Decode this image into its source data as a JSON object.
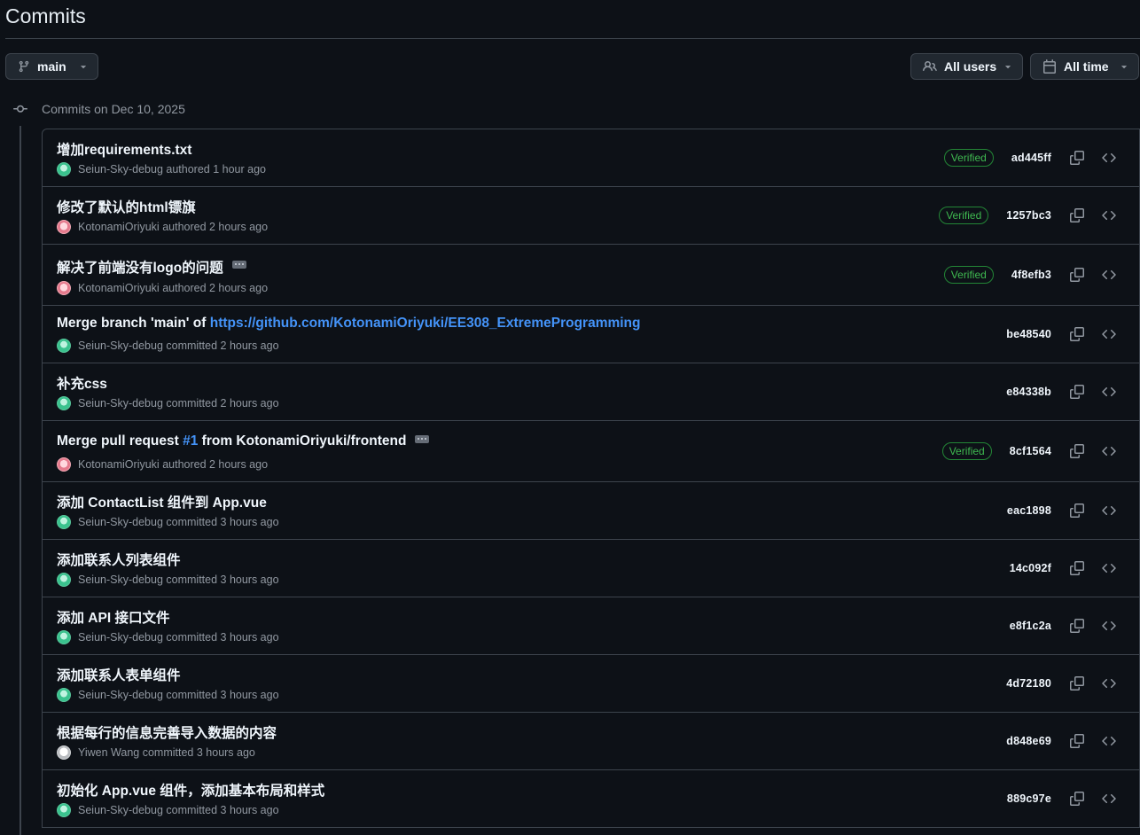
{
  "page": {
    "title": "Commits"
  },
  "filters": {
    "branch": {
      "label": "main",
      "icon": "git-branch-icon"
    },
    "users": {
      "label": "All users",
      "icon": "people-icon"
    },
    "time": {
      "label": "All time",
      "icon": "calendar-icon"
    }
  },
  "group": {
    "label": "Commits on Dec 10, 2025",
    "icon": "git-commit-icon"
  },
  "commits": [
    {
      "message": "增加requirements.txt",
      "author": "Seiun-Sky-debug",
      "action": "authored 1 hour ago",
      "verified": "Verified",
      "sha": "ad445ff",
      "avatar": "green"
    },
    {
      "message": "修改了默认的html镖旗",
      "author": "KotonamiOriyuki",
      "action": "authored 2 hours ago",
      "verified": "Verified",
      "sha": "1257bc3",
      "avatar": "pink"
    },
    {
      "message": "解决了前端没有logo的问题",
      "author": "KotonamiOriyuki",
      "action": "authored 2 hours ago",
      "verified": "Verified",
      "sha": "4f8efb3",
      "avatar": "pink",
      "expandable": true
    },
    {
      "message_prefix": "Merge branch 'main' of ",
      "message_link": "https://github.com/KotonamiOriyuki/EE308_ExtremeProgramming",
      "author": "Seiun-Sky-debug",
      "action": "committed 2 hours ago",
      "sha": "be48540",
      "avatar": "green"
    },
    {
      "message": "补充css",
      "author": "Seiun-Sky-debug",
      "action": "committed 2 hours ago",
      "sha": "e84338b",
      "avatar": "green"
    },
    {
      "message_prefix": "Merge pull request ",
      "message_link": "#1",
      "message_suffix": " from KotonamiOriyuki/frontend",
      "author": "KotonamiOriyuki",
      "action": "authored 2 hours ago",
      "verified": "Verified",
      "sha": "8cf1564",
      "avatar": "pink",
      "expandable": true
    },
    {
      "message": "添加 ContactList 组件到 App.vue",
      "author": "Seiun-Sky-debug",
      "action": "committed 3 hours ago",
      "sha": "eac1898",
      "avatar": "green"
    },
    {
      "message": "添加联系人列表组件",
      "author": "Seiun-Sky-debug",
      "action": "committed 3 hours ago",
      "sha": "14c092f",
      "avatar": "green"
    },
    {
      "message": "添加 API 接口文件",
      "author": "Seiun-Sky-debug",
      "action": "committed 3 hours ago",
      "sha": "e8f1c2a",
      "avatar": "green"
    },
    {
      "message": "添加联系人表单组件",
      "author": "Seiun-Sky-debug",
      "action": "committed 3 hours ago",
      "sha": "4d72180",
      "avatar": "green"
    },
    {
      "message": "根据每行的信息完善导入数据的内容",
      "author": "Yiwen Wang",
      "action": "committed 3 hours ago",
      "sha": "d848e69",
      "avatar": "gray"
    },
    {
      "message": "初始化 App.vue 组件，添加基本布局和样式",
      "author": "Seiun-Sky-debug",
      "action": "committed 3 hours ago",
      "sha": "889c97e",
      "avatar": "green"
    }
  ],
  "icons": {
    "copy": "copy-icon",
    "browse": "code-icon",
    "more": "ellipsis-icon"
  },
  "colors": {
    "background": "#0d1117",
    "border": "#3d444d",
    "verified": "#3fb950",
    "link": "#4493f8"
  }
}
